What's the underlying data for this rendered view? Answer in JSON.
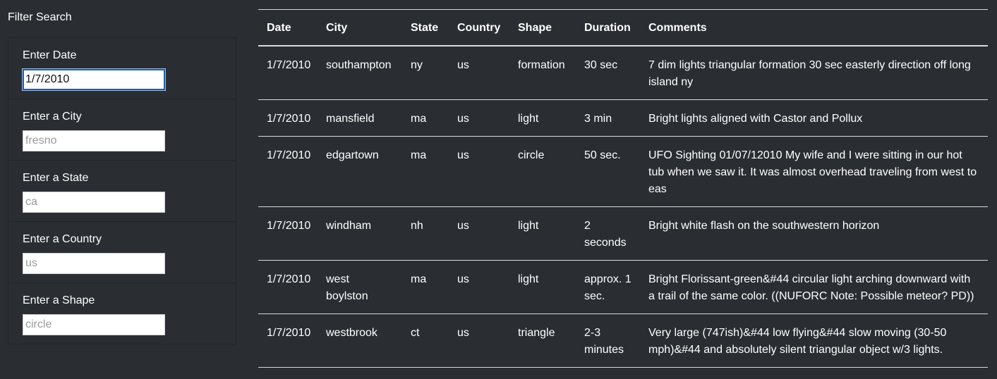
{
  "filter": {
    "title": "Filter Search",
    "fields": [
      {
        "label": "Enter Date",
        "value": "1/7/2010",
        "placeholder": ""
      },
      {
        "label": "Enter a City",
        "value": "",
        "placeholder": "fresno"
      },
      {
        "label": "Enter a State",
        "value": "",
        "placeholder": "ca"
      },
      {
        "label": "Enter a Country",
        "value": "",
        "placeholder": "us"
      },
      {
        "label": "Enter a Shape",
        "value": "",
        "placeholder": "circle"
      }
    ]
  },
  "table": {
    "headers": [
      "Date",
      "City",
      "State",
      "Country",
      "Shape",
      "Duration",
      "Comments"
    ],
    "rows": [
      [
        "1/7/2010",
        "southampton",
        "ny",
        "us",
        "formation",
        "30 sec",
        "7 dim lights triangular formation 30 sec easterly direction off long island ny"
      ],
      [
        "1/7/2010",
        "mansfield",
        "ma",
        "us",
        "light",
        "3 min",
        "Bright lights aligned with Castor and Pollux"
      ],
      [
        "1/7/2010",
        "edgartown",
        "ma",
        "us",
        "circle",
        "50 sec.",
        "UFO Sighting 01/07/12010 My wife and I were sitting in our hot tub when we saw it. It was almost overhead traveling from west to eas"
      ],
      [
        "1/7/2010",
        "windham",
        "nh",
        "us",
        "light",
        "2 seconds",
        "Bright white flash on the southwestern horizon"
      ],
      [
        "1/7/2010",
        "west boylston",
        "ma",
        "us",
        "light",
        "approx. 1 sec.",
        "Bright Florissant-green&#44 circular light arching downward with a trail of the same color. ((NUFORC Note: Possible meteor? PD))"
      ],
      [
        "1/7/2010",
        "westbrook",
        "ct",
        "us",
        "triangle",
        "2-3 minutes",
        "Very large (747ish)&#44 low flying&#44 slow moving (30-50 mph)&#44 and absolutely silent triangular object w/3 lights."
      ]
    ]
  }
}
